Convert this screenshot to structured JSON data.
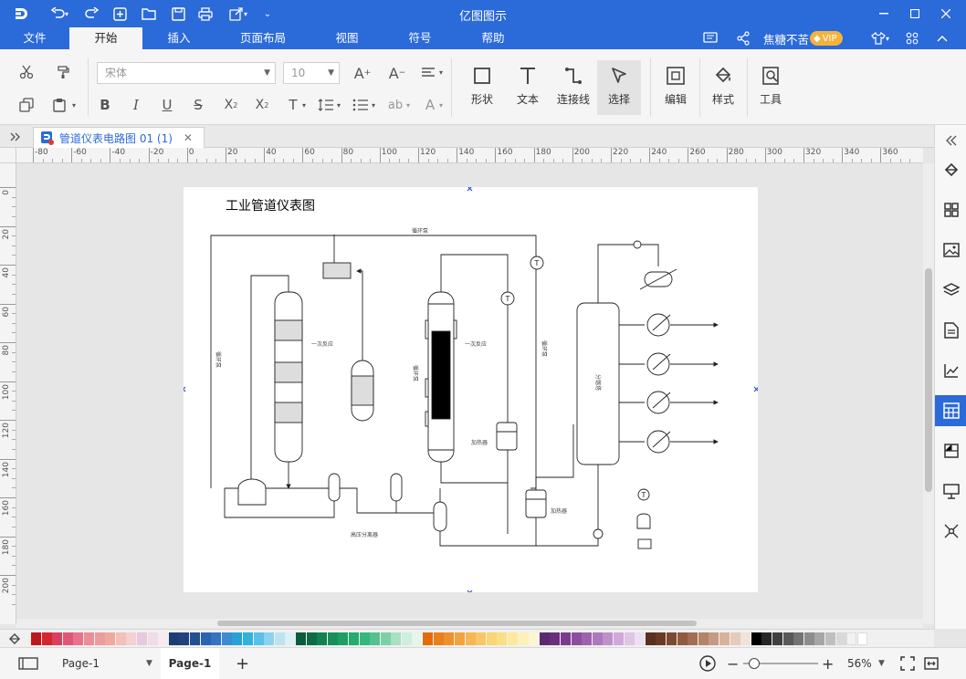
{
  "app": {
    "title": "亿图图示"
  },
  "menu": {
    "tabs": [
      {
        "label": "文件"
      },
      {
        "label": "开始"
      },
      {
        "label": "插入"
      },
      {
        "label": "页面布局"
      },
      {
        "label": "视图"
      },
      {
        "label": "符号"
      },
      {
        "label": "帮助"
      }
    ],
    "active": "开始",
    "user_name": "焦糖不苦",
    "vip_label": "VIP"
  },
  "ribbon": {
    "font_family": "宋体",
    "font_size": "10",
    "shape_label": "形状",
    "text_label": "文本",
    "connector_label": "连接线",
    "select_label": "选择",
    "edit_label": "编辑",
    "style_label": "样式",
    "tools_label": "工具"
  },
  "document": {
    "tab_label": "管道仪表电路图 01 (1)"
  },
  "rulers": {
    "horizontal": [
      "-80",
      "-60",
      "-40",
      "-20",
      "0",
      "20",
      "40",
      "60",
      "80",
      "100",
      "120",
      "140",
      "160",
      "180",
      "200",
      "220",
      "240",
      "260",
      "280",
      "300",
      "320",
      "340",
      "360"
    ],
    "vertical": [
      "0",
      "20",
      "40",
      "60",
      "80",
      "100",
      "120",
      "140",
      "160",
      "180",
      "200"
    ]
  },
  "diagram": {
    "title": "工业管道仪表图",
    "labels": {
      "top_loop": "循环泵",
      "left_pipe": "循环泵",
      "reactor1": "一次反应",
      "reactor2": "一次反应",
      "mid_pipe": "循环泵",
      "right_pipe": "循环泵",
      "heater1": "加热器",
      "heater2": "加热器",
      "separator": "高压分离器",
      "column": "分馏塔"
    },
    "instrument_symbol": "T"
  },
  "palette": {
    "colors": [
      "#c0161b",
      "#d3262e",
      "#d8405d",
      "#e05679",
      "#e8728a",
      "#ea8e97",
      "#ec9b9e",
      "#f1aa9a",
      "#f4bfb5",
      "#f4d0d0",
      "#e8c8dc",
      "#eddde8",
      "#f7eaf0",
      "#1b3d73",
      "#21427d",
      "#234e92",
      "#2a64b0",
      "#3474c0",
      "#3d8bd3",
      "#2aa0d8",
      "#2fb2e0",
      "#59c1e8",
      "#8dd3ee",
      "#bde3f2",
      "#dcf0f7",
      "#0b5c3c",
      "#0e6b45",
      "#13804f",
      "#178f59",
      "#1ca063",
      "#22ac6d",
      "#35b77c",
      "#54c18e",
      "#7cd0a8",
      "#a8e0c3",
      "#cfeedd",
      "#e5f6ec",
      "#e36c0a",
      "#e8801c",
      "#ee912d",
      "#f2a33f",
      "#f5b653",
      "#f8c763",
      "#f9d575",
      "#fadf85",
      "#fce99b",
      "#fdf1b8",
      "#fdf6d3",
      "#5b2a6e",
      "#6b2e7e",
      "#7b3a8e",
      "#8d4e9f",
      "#9e63ae",
      "#ae78bd",
      "#bf91cb",
      "#cfaad8",
      "#dec4e5",
      "#ecdff1",
      "#5a3020",
      "#6b3a26",
      "#7d4830",
      "#8f5a40",
      "#a26d53",
      "#b48368",
      "#c69a82",
      "#d7b29f",
      "#e6cbbd",
      "#f1e2da",
      "#000000",
      "#262626",
      "#404040",
      "#595959",
      "#737373",
      "#8c8c8c",
      "#a6a6a6",
      "#bfbfbf",
      "#d9d9d9",
      "#f2f2f2",
      "#ffffff"
    ]
  },
  "status": {
    "page_selector": "Page-1",
    "page_tab": "Page-1",
    "zoom": "56%"
  }
}
